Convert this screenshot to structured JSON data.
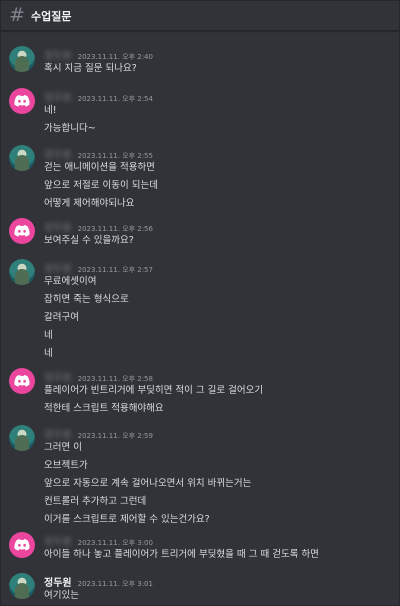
{
  "channel": {
    "name": "수업질문"
  },
  "messages": [
    {
      "author": "정두원",
      "time": "2023.11.11. 오후 2:40",
      "lines": [
        "혹시 지금 질문 되나요?"
      ]
    },
    {
      "author": "정두원",
      "time": "2023.11.11. 오후 2:54",
      "lines": [
        "네!",
        "가능합니다~"
      ]
    },
    {
      "author": "정두원",
      "time": "2023.11.11. 오후 2:55",
      "lines": [
        "걷는 애니메이션을 적용하면",
        "앞으로 저절로 이동이 되는데",
        "어떻게 제어해야되나요"
      ]
    },
    {
      "author": "정두원",
      "time": "2023.11.11. 오후 2:56",
      "lines": [
        "보여주실 수 있을까요?"
      ]
    },
    {
      "author": "정두원",
      "time": "2023.11.11. 오후 2:57",
      "lines": [
        "무료에셋이여",
        "잡히면 죽는 형식으로",
        "갈려구여",
        "네",
        "네"
      ]
    },
    {
      "author": "정두원",
      "time": "2023.11.11. 오후 2:58",
      "lines": [
        "플레이어가 빈트리거에 부딪히면 적이 그 길로 걸어오기",
        "적한테 스크립트 적용해야해요"
      ]
    },
    {
      "author": "정두원",
      "time": "2023.11.11. 오후 2:59",
      "lines": [
        "그러면 이",
        "오브젝트가",
        "앞으로 자동으로 계속 걸어나오면서 위치 바뀌는거는",
        "컨트롤러 추가하고 그런데",
        "이거를 스크립트로 제어할 수 있는건가요?"
      ]
    },
    {
      "author": "정두원",
      "time": "2023.11.11. 오후 3:00",
      "lines": [
        "아이들 하나 놓고 플레이어가 트리거에 부딪혔을 때 그 때 걷도록 하면"
      ]
    },
    {
      "author": "정두원",
      "time": "2023.11.11. 오후 3:01",
      "lines": [
        "여기있는"
      ]
    }
  ],
  "colors": {
    "background": "#313338",
    "bot_avatar": "#eb459e",
    "text": "#dbdee1",
    "muted": "#949ba4"
  }
}
